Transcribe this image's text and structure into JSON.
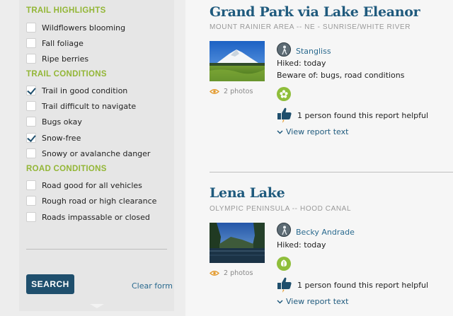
{
  "sidebar": {
    "trail_highlights": {
      "heading": "TRAIL HIGHLIGHTS",
      "items": [
        {
          "label": "Wildflowers blooming",
          "checked": false
        },
        {
          "label": "Fall foliage",
          "checked": false
        },
        {
          "label": "Ripe berries",
          "checked": false
        }
      ]
    },
    "trail_conditions": {
      "heading": "TRAIL CONDITIONS",
      "items": [
        {
          "label": "Trail in good condition",
          "checked": true
        },
        {
          "label": "Trail difficult to navigate",
          "checked": false
        },
        {
          "label": "Bugs okay",
          "checked": false
        },
        {
          "label": "Snow-free",
          "checked": true
        },
        {
          "label": "Snowy or avalanche danger",
          "checked": false
        }
      ]
    },
    "road_conditions": {
      "heading": "ROAD CONDITIONS",
      "items": [
        {
          "label": "Road good for all vehicles",
          "checked": false
        },
        {
          "label": "Rough road or high clearance",
          "checked": false
        },
        {
          "label": "Roads impassable or closed",
          "checked": false
        }
      ]
    },
    "search_label": "SEARCH",
    "clear_label": "Clear form"
  },
  "reports": [
    {
      "title": "Grand Park via Lake Eleanor",
      "region": "MOUNT RAINIER AREA -- NE - SUNRISE/WHITE RIVER",
      "photos": "2 photos",
      "author": "Stangliss",
      "hiked": "Hiked: today",
      "beware": "Beware of: bugs, road conditions",
      "helpful": "1 person found this report helpful",
      "view": "View report text",
      "badge_icon": "flower-icon"
    },
    {
      "title": "Lena Lake",
      "region": "OLYMPIC PENINSULA -- HOOD CANAL",
      "photos": "2 photos",
      "author": "Becky Andrade",
      "hiked": "Hiked: today",
      "helpful": "1 person found this report helpful",
      "view": "View report text",
      "badge_icon": "leaf-icon"
    }
  ],
  "colors": {
    "accent_green": "#93b636",
    "brand_blue": "#1f4f6d",
    "link_blue": "#2a6a8f"
  }
}
